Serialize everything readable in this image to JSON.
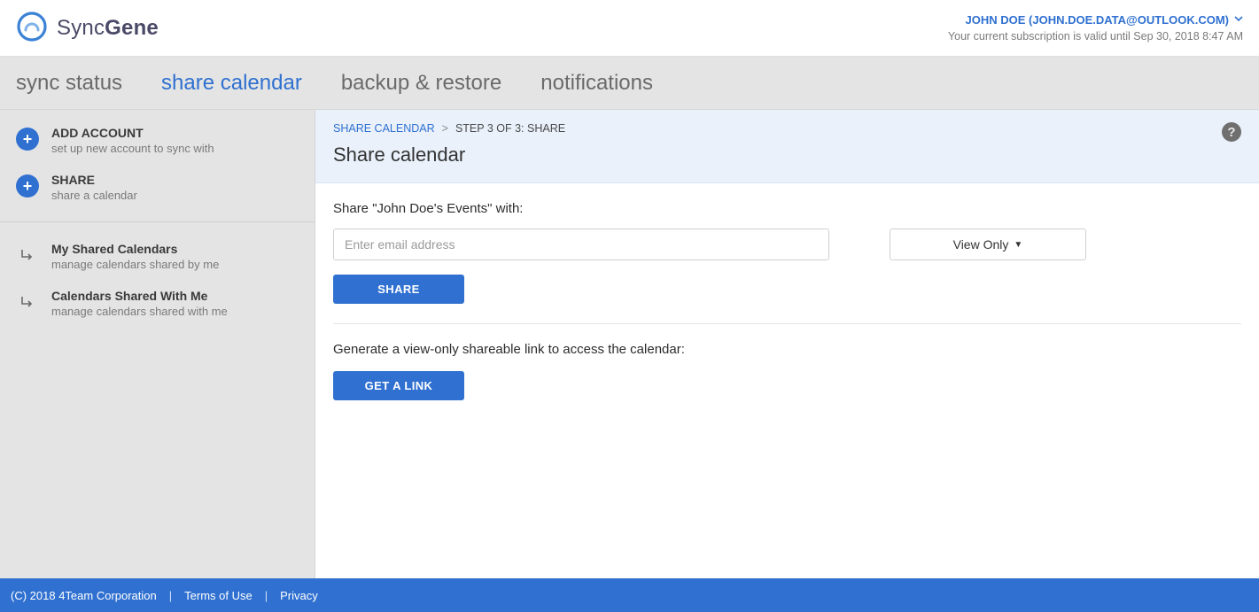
{
  "header": {
    "brand_prefix": "Sync",
    "brand_suffix": "Gene",
    "user_label": "JOHN DOE (JOHN.DOE.DATA@OUTLOOK.COM)",
    "subscription_label": "Your current subscription is valid until Sep 30, 2018 8:47 AM"
  },
  "tabs": {
    "sync_status": "sync status",
    "share_calendar": "share calendar",
    "backup_restore": "backup & restore",
    "notifications": "notifications"
  },
  "sidebar": {
    "add_account": {
      "title": "ADD ACCOUNT",
      "sub": "set up new account to sync with"
    },
    "share": {
      "title": "SHARE",
      "sub": "share a calendar"
    },
    "my_shared": {
      "title": "My Shared Calendars",
      "sub": "manage calendars shared by me"
    },
    "shared_with": {
      "title": "Calendars Shared With Me",
      "sub": "manage calendars shared with me"
    }
  },
  "breadcrumb": {
    "link": "SHARE CALENDAR",
    "step": "STEP 3 OF 3: SHARE"
  },
  "page_title": "Share calendar",
  "share": {
    "with_label": "Share \"John Doe's Events\" with:",
    "email_placeholder": "Enter email address",
    "email_value": "",
    "permission_selected": "View Only",
    "share_button": "SHARE",
    "link_label": "Generate a view-only shareable link to access the calendar:",
    "link_button": "GET A LINK"
  },
  "footer": {
    "copyright": "(C) 2018  4Team Corporation",
    "terms": "Terms of Use",
    "privacy": "Privacy"
  }
}
